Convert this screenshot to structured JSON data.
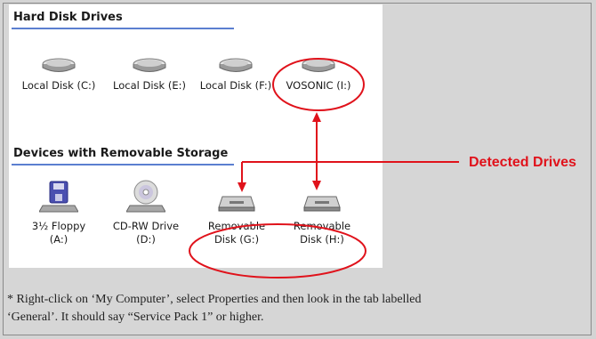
{
  "explorer": {
    "hard_disk_title": "Hard Disk Drives",
    "hard_disks": [
      {
        "label": "Local Disk (C:)",
        "icon": "hard-disk-icon"
      },
      {
        "label": "Local Disk (E:)",
        "icon": "hard-disk-icon"
      },
      {
        "label": "Local Disk (F:)",
        "icon": "hard-disk-icon"
      },
      {
        "label": "VOSONIC (I:)",
        "icon": "hard-disk-icon"
      }
    ],
    "removable_title": "Devices with Removable Storage",
    "removable": [
      {
        "label1": "3½ Floppy",
        "label2": "(A:)",
        "icon": "floppy-drive-icon"
      },
      {
        "label1": "CD-RW Drive",
        "label2": "(D:)",
        "icon": "cd-drive-icon"
      },
      {
        "label1": "Removable",
        "label2": "Disk (G:)",
        "icon": "removable-disk-icon"
      },
      {
        "label1": "Removable",
        "label2": "Disk (H:)",
        "icon": "removable-disk-icon"
      }
    ]
  },
  "annotation": {
    "callout": "Detected Drives",
    "accent_color": "#e0121b"
  },
  "note": {
    "line1": "* Right-click on ‘My Computer’, select Properties and then look in the tab labelled",
    "line2": "‘General’. It should say “Service Pack 1” or higher."
  }
}
